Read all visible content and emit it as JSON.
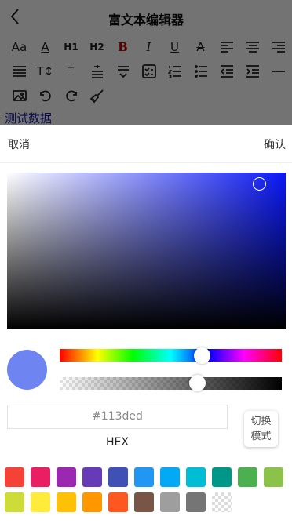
{
  "header": {
    "title": "富文本编辑器"
  },
  "toolbar": {
    "row1": [
      {
        "name": "font-size-icon",
        "glyph": "Aa"
      },
      {
        "name": "font-color-icon",
        "glyph": "A"
      },
      {
        "name": "heading1-icon",
        "glyph": "H1"
      },
      {
        "name": "heading2-icon",
        "glyph": "H2"
      },
      {
        "name": "bold-icon",
        "glyph": "B"
      },
      {
        "name": "italic-icon",
        "glyph": "I"
      },
      {
        "name": "underline-icon",
        "glyph": "U"
      },
      {
        "name": "strikethrough-icon",
        "glyph": "A"
      },
      {
        "name": "align-left-icon",
        "glyph": ""
      },
      {
        "name": "align-center-icon",
        "glyph": ""
      },
      {
        "name": "align-right-icon",
        "glyph": ""
      }
    ],
    "row2": [
      {
        "name": "justify-icon"
      },
      {
        "name": "line-height-icon",
        "glyph": "T↕"
      },
      {
        "name": "letter-spacing-icon",
        "glyph": "⌶"
      },
      {
        "name": "paragraph-spacing-icon"
      },
      {
        "name": "space-below-icon"
      },
      {
        "name": "checklist-icon"
      },
      {
        "name": "ordered-list-icon"
      },
      {
        "name": "bullet-list-icon"
      },
      {
        "name": "outdent-icon"
      },
      {
        "name": "indent-icon"
      },
      {
        "name": "horizontal-rule-icon"
      }
    ],
    "row3": [
      {
        "name": "image-icon"
      },
      {
        "name": "undo-icon"
      },
      {
        "name": "redo-icon"
      },
      {
        "name": "clear-format-icon"
      }
    ]
  },
  "editor": {
    "content": "测试数据"
  },
  "sheet": {
    "cancel_label": "取消",
    "confirm_label": "确认"
  },
  "picker": {
    "hex_value": "#113ded",
    "hex_label": "HEX",
    "mode_label": "切换模式",
    "preview_color": "#6e84f0",
    "hue_position": 0.64,
    "alpha_position": 0.62
  },
  "swatches": [
    [
      "#f44336",
      "#e91e63",
      "#9c27b0",
      "#673ab7",
      "#3f51b5",
      "#2196f3",
      "#03a9f4",
      "#00bcd4",
      "#009688",
      "#4caf50",
      "#8bc34a"
    ],
    [
      "#cddc39",
      "#ffeb3b",
      "#ffc107",
      "#ff9800",
      "#ff5722",
      "#795548",
      "#9e9e9e",
      "#757575",
      "transparent"
    ]
  ]
}
